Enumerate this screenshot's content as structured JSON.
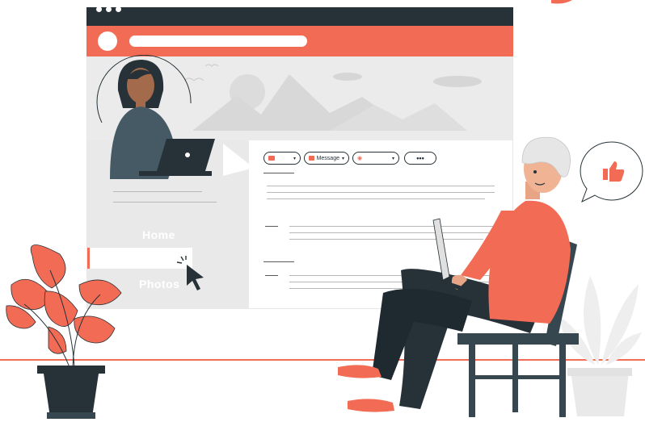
{
  "profile": {
    "nav_items": [
      "Home",
      "Photos"
    ],
    "action_buttons": [
      {
        "icon": "thumbs-up-icon",
        "label": ""
      },
      {
        "icon": "message-icon",
        "label": "Message"
      },
      {
        "icon": "rss-icon",
        "label": ""
      },
      {
        "icon": "more-icon",
        "label": "•••"
      }
    ]
  },
  "colors": {
    "accent": "#f26b55",
    "dark": "#263238",
    "light_gray": "#ebebeb"
  },
  "speech_bubble": {
    "icon": "thumbs-up-icon"
  }
}
